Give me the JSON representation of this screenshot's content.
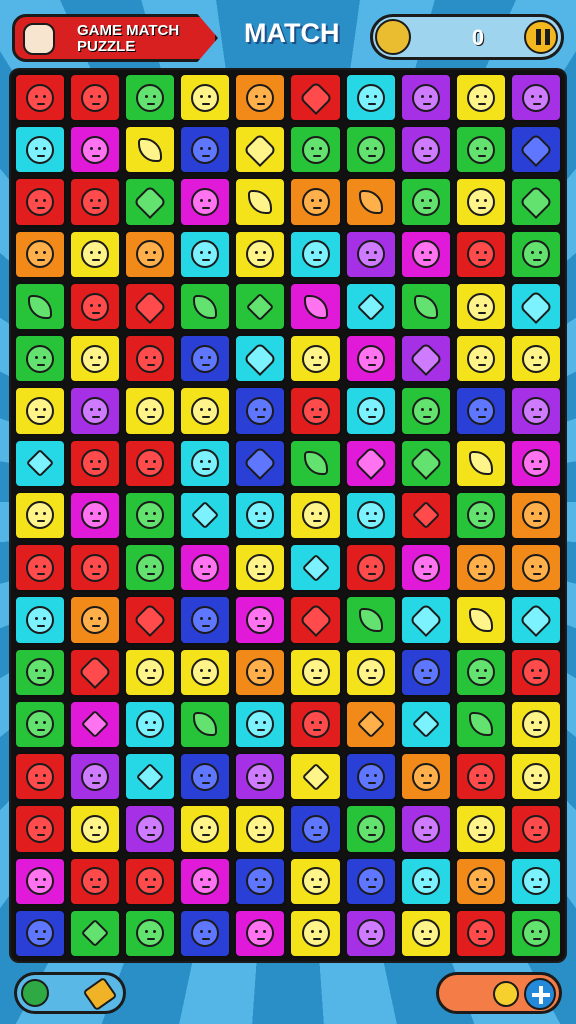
{
  "header": {
    "title": "GAME MATCH PUZZLE",
    "mode_label": "MATCH",
    "score": "0",
    "score_icon": "pencil-icon",
    "pause_icon": "pause-icon",
    "title_icon": "cat-icon"
  },
  "board": {
    "rows": 17,
    "cols": 10,
    "palette": {
      "r": "#e11d1d",
      "o": "#f28a1a",
      "y": "#f4e21a",
      "g": "#27c43a",
      "lg": "#7cdb1e",
      "c": "#26d8e6",
      "b": "#2a3fd6",
      "p": "#a630e6",
      "m": "#e01ad8",
      "k": "#2b2b2b"
    },
    "cells": [
      [
        "r",
        "r",
        "g",
        "y",
        "o",
        "r",
        "c",
        "p",
        "y",
        "p"
      ],
      [
        "c",
        "m",
        "y",
        "b",
        "y",
        "g",
        "g",
        "p",
        "g",
        "b"
      ],
      [
        "r",
        "r",
        "g",
        "m",
        "y",
        "o",
        "o",
        "g",
        "y",
        "g"
      ],
      [
        "o",
        "y",
        "o",
        "c",
        "y",
        "c",
        "p",
        "m",
        "r",
        "g"
      ],
      [
        "g",
        "r",
        "r",
        "g",
        "g",
        "m",
        "c",
        "g",
        "y",
        "c"
      ],
      [
        "g",
        "y",
        "r",
        "b",
        "c",
        "y",
        "m",
        "p",
        "y",
        "y"
      ],
      [
        "y",
        "p",
        "y",
        "y",
        "b",
        "r",
        "c",
        "g",
        "b",
        "p"
      ],
      [
        "c",
        "r",
        "r",
        "c",
        "b",
        "g",
        "m",
        "g",
        "y",
        "m"
      ],
      [
        "y",
        "m",
        "g",
        "c",
        "c",
        "y",
        "c",
        "r",
        "g",
        "o"
      ],
      [
        "r",
        "r",
        "g",
        "m",
        "y",
        "c",
        "r",
        "m",
        "o",
        "o"
      ],
      [
        "c",
        "o",
        "r",
        "b",
        "m",
        "r",
        "g",
        "c",
        "y",
        "c"
      ],
      [
        "g",
        "r",
        "y",
        "y",
        "o",
        "y",
        "y",
        "b",
        "g",
        "r"
      ],
      [
        "g",
        "m",
        "c",
        "g",
        "c",
        "r",
        "o",
        "c",
        "g",
        "y"
      ],
      [
        "r",
        "p",
        "c",
        "b",
        "p",
        "y",
        "b",
        "o",
        "r",
        "y"
      ],
      [
        "r",
        "y",
        "p",
        "y",
        "y",
        "b",
        "g",
        "p",
        "y",
        "r"
      ],
      [
        "m",
        "r",
        "r",
        "m",
        "b",
        "y",
        "b",
        "c",
        "o",
        "c"
      ],
      [
        "b",
        "g",
        "g",
        "b",
        "m",
        "y",
        "p",
        "y",
        "r",
        "g"
      ]
    ],
    "icons": [
      [
        "face",
        "face",
        "face",
        "face",
        "face",
        "heart",
        "face",
        "face",
        "face",
        "face"
      ],
      [
        "face",
        "face",
        "leaf",
        "face",
        "heart",
        "face",
        "face",
        "face",
        "face",
        "heart"
      ],
      [
        "face",
        "face",
        "heart",
        "face",
        "leaf",
        "face",
        "leaf",
        "face",
        "face",
        "heart"
      ],
      [
        "face",
        "face",
        "face",
        "face",
        "face",
        "face",
        "face",
        "face",
        "face",
        "face"
      ],
      [
        "leaf",
        "face",
        "heart",
        "leaf",
        "diamond",
        "leaf",
        "diamond",
        "leaf",
        "face",
        "heart"
      ],
      [
        "face",
        "face",
        "face",
        "face",
        "heart",
        "face",
        "face",
        "heart",
        "face",
        "face"
      ],
      [
        "face",
        "face",
        "face",
        "face",
        "face",
        "face",
        "face",
        "face",
        "face",
        "face"
      ],
      [
        "diamond",
        "face",
        "face",
        "face",
        "heart",
        "leaf",
        "heart",
        "heart",
        "leaf",
        "face"
      ],
      [
        "face",
        "face",
        "face",
        "diamond",
        "face",
        "face",
        "face",
        "diamond",
        "face",
        "face"
      ],
      [
        "face",
        "face",
        "face",
        "face",
        "face",
        "diamond",
        "face",
        "face",
        "face",
        "face"
      ],
      [
        "face",
        "face",
        "heart",
        "face",
        "face",
        "heart",
        "leaf",
        "heart",
        "leaf",
        "heart"
      ],
      [
        "face",
        "heart",
        "face",
        "face",
        "face",
        "face",
        "face",
        "face",
        "face",
        "face"
      ],
      [
        "face",
        "diamond",
        "face",
        "leaf",
        "face",
        "face",
        "diamond",
        "diamond",
        "leaf",
        "face"
      ],
      [
        "face",
        "face",
        "diamond",
        "face",
        "face",
        "diamond",
        "face",
        "face",
        "face",
        "face"
      ],
      [
        "face",
        "face",
        "face",
        "face",
        "face",
        "face",
        "face",
        "face",
        "face",
        "face"
      ],
      [
        "face",
        "face",
        "face",
        "face",
        "face",
        "face",
        "face",
        "face",
        "face",
        "face"
      ],
      [
        "face",
        "diamond",
        "face",
        "face",
        "face",
        "face",
        "face",
        "face",
        "face",
        "face"
      ]
    ]
  },
  "footer": {
    "left_icons": [
      "leaf-icon",
      "pencil-icon"
    ],
    "right_icons": [
      "mascot-icon",
      "plus-icon"
    ]
  }
}
